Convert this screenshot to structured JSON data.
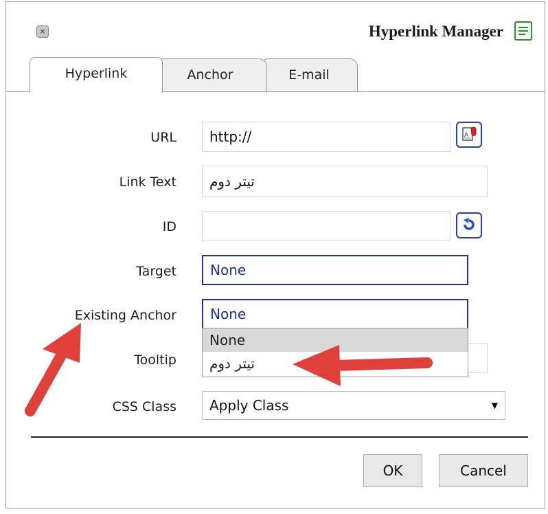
{
  "dialog": {
    "title": "Hyperlink Manager",
    "close_glyph": "×",
    "close_icon": "close-icon",
    "title_icon": "document-lines-icon"
  },
  "tabs": [
    {
      "label": "Hyperlink",
      "active": true
    },
    {
      "label": "Anchor",
      "active": false
    },
    {
      "label": "E-mail",
      "active": false
    }
  ],
  "form": {
    "url": {
      "label": "URL",
      "value": "http://",
      "button_icon": "document-browse-icon"
    },
    "link_text": {
      "label": "Link Text",
      "value": "تیتر دوم"
    },
    "id": {
      "label": "ID",
      "value": "",
      "button_icon": "refresh-icon"
    },
    "target": {
      "label": "Target",
      "value": "None"
    },
    "existing_anchor": {
      "label": "Existing Anchor",
      "value": "None",
      "options": [
        "None",
        "تیتر دوم"
      ],
      "highlighted_option": "None"
    },
    "tooltip": {
      "label": "Tooltip",
      "value": ""
    },
    "css_class": {
      "label": "CSS Class",
      "value": "Apply Class"
    }
  },
  "buttons": {
    "ok": "OK",
    "cancel": "Cancel"
  },
  "annotations": {
    "arrow_color": "#e0403a",
    "arrow_icons": [
      "arrow-annotation-icon",
      "arrow-annotation-icon"
    ]
  },
  "colors": {
    "focus_border": "#1f2fc4",
    "selected_option_bg": "#d9d9d9"
  }
}
